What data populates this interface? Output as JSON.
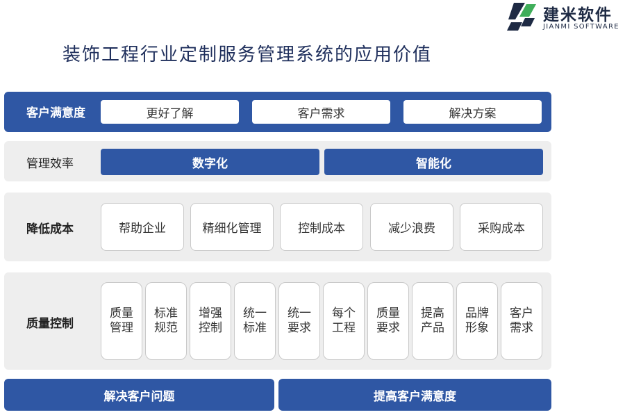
{
  "logo": {
    "name_cn": "建米软件",
    "name_en": "JIANMI SOFTWARE"
  },
  "title": "装饰工程行业定制服务管理系统的应用价值",
  "rows": [
    {
      "label": "客户满意度",
      "items": [
        "更好了解",
        "客户需求",
        "解决方案"
      ]
    },
    {
      "label": "管理效率",
      "items": [
        "数字化",
        "智能化"
      ]
    },
    {
      "label": "降低成本",
      "items": [
        "帮助企业",
        "精细化管理",
        "控制成本",
        "减少浪费",
        "采购成本"
      ]
    },
    {
      "label": "质量控制",
      "items": [
        [
          "质量",
          "管理"
        ],
        [
          "标准",
          "规范"
        ],
        [
          "增强",
          "控制"
        ],
        [
          "统一",
          "标准"
        ],
        [
          "统一",
          "要求"
        ],
        [
          "每个",
          "工程"
        ],
        [
          "质量",
          "要求"
        ],
        [
          "提高",
          "产品"
        ],
        [
          "品牌",
          "形象"
        ],
        [
          "客户",
          "需求"
        ]
      ]
    }
  ],
  "bottom": [
    "解决客户问题",
    "提高客户满意度"
  ],
  "colors": {
    "primary": "#2f57a4",
    "panel": "#eeeeee",
    "title": "#1f2f5c",
    "logo_green": "#3fae5a",
    "logo_navy": "#1e2a44"
  }
}
